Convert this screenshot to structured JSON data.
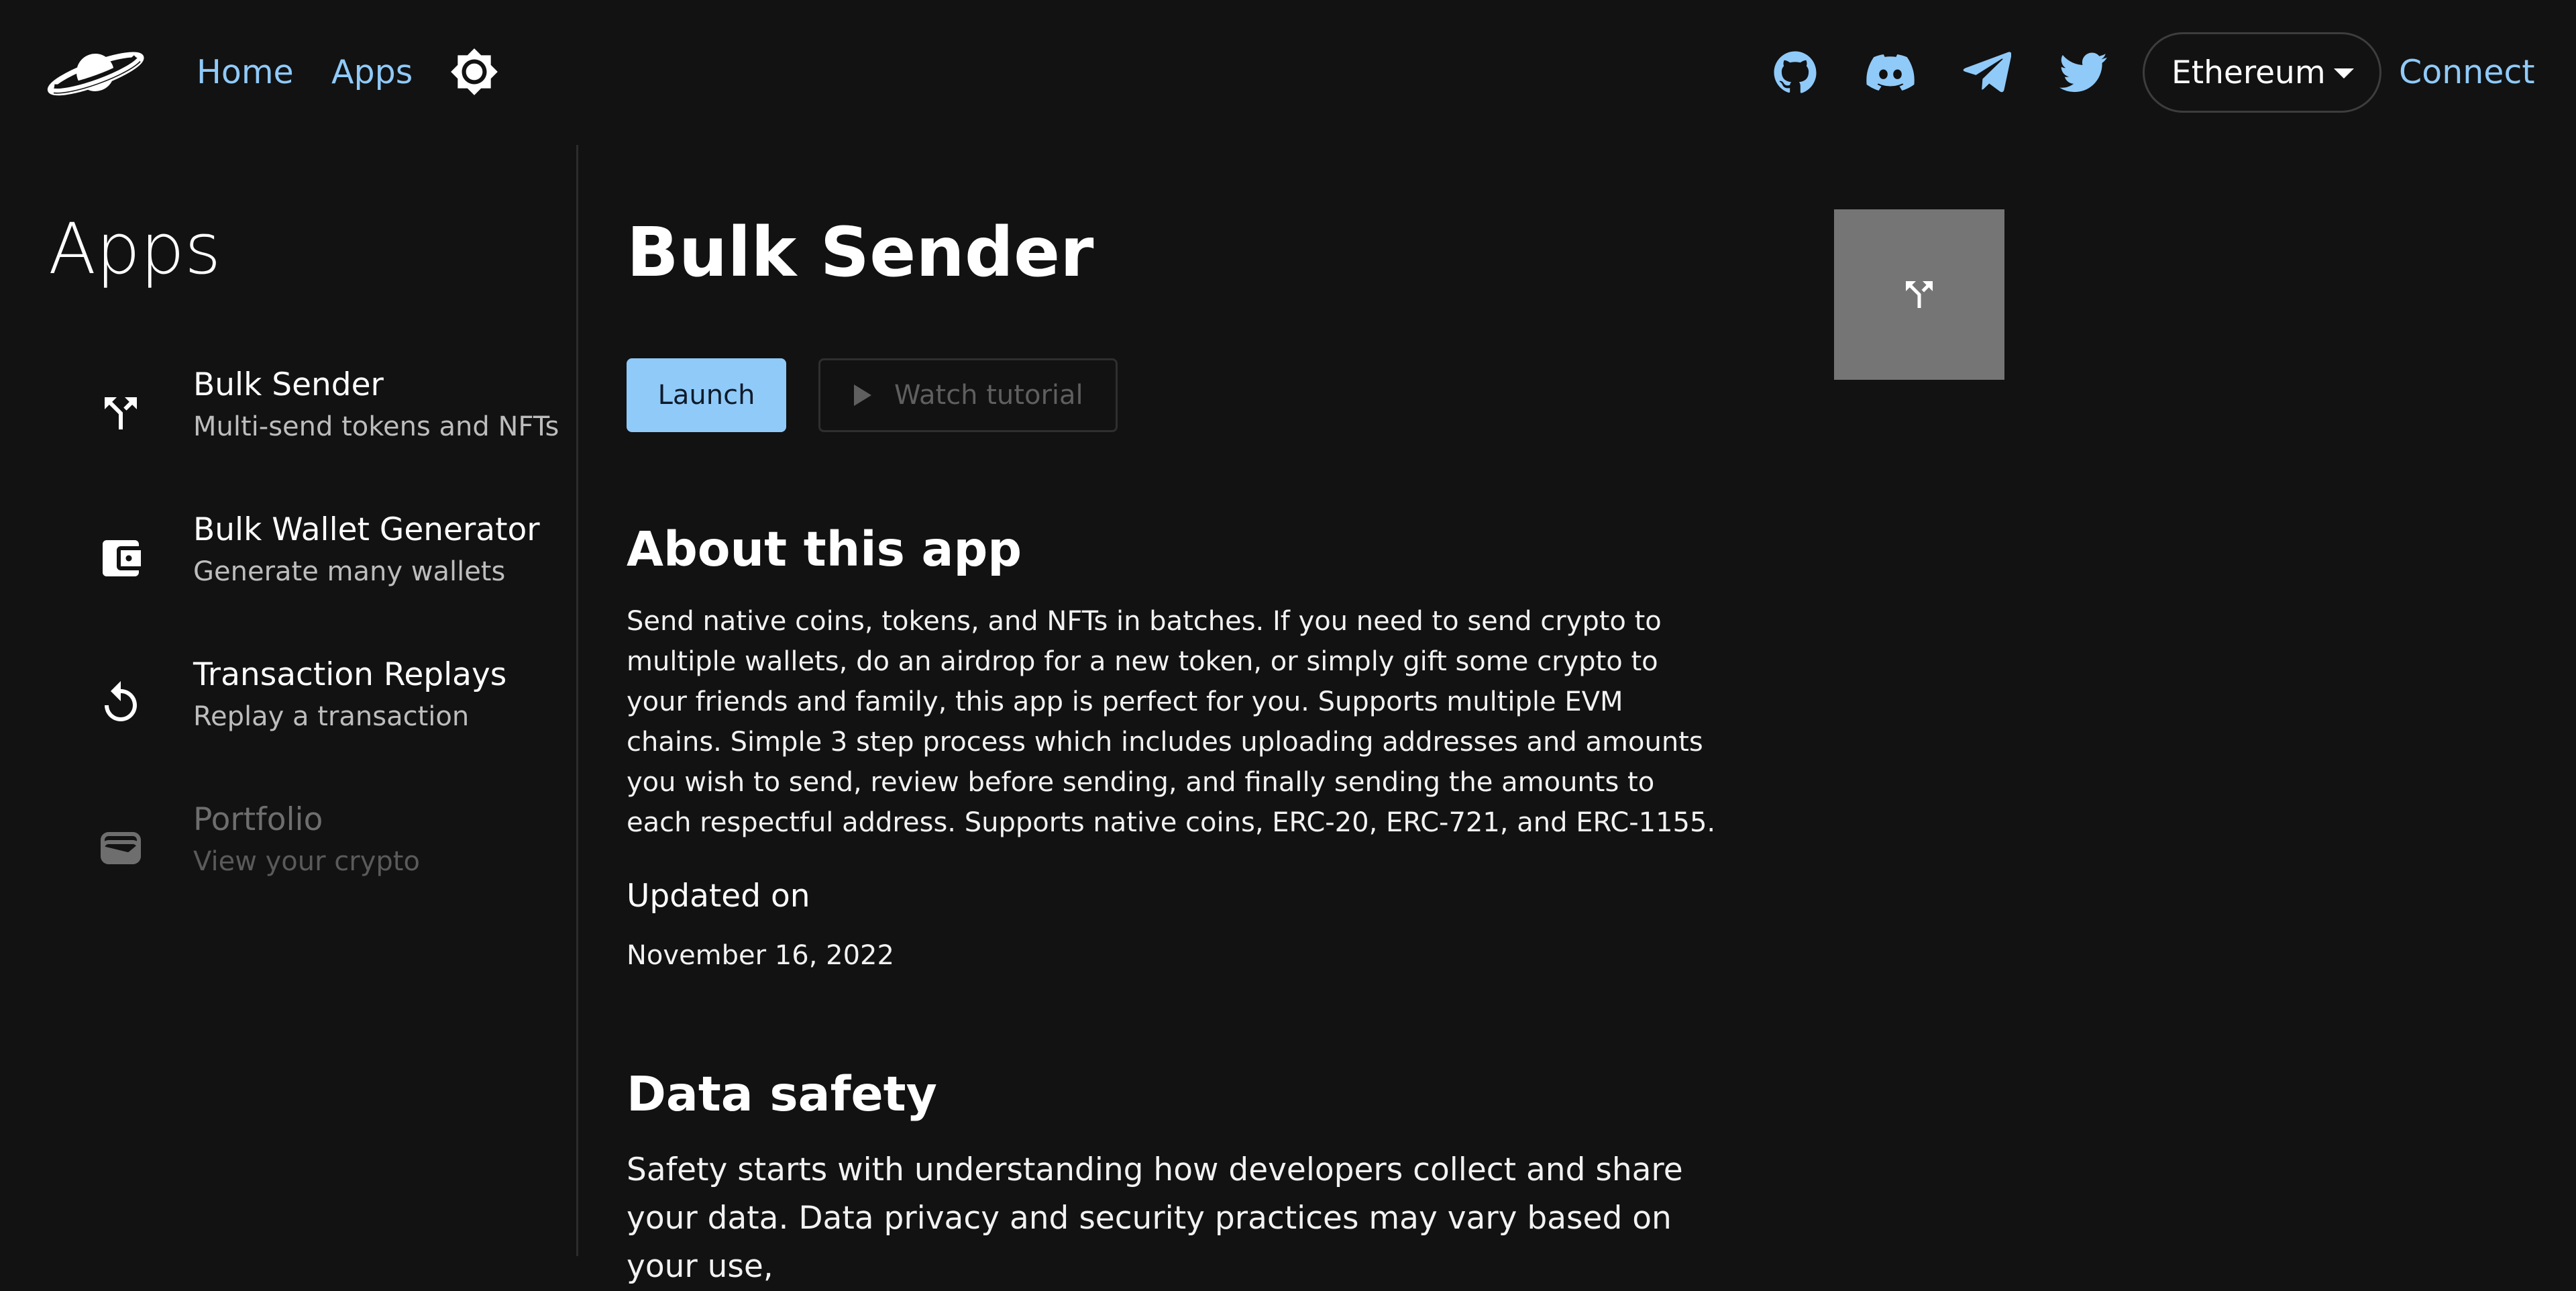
{
  "header": {
    "nav": {
      "home": "Home",
      "apps": "Apps"
    },
    "network": {
      "selected": "Ethereum"
    },
    "connect_label": "Connect",
    "social_icons": [
      "github-icon",
      "discord-icon",
      "telegram-icon",
      "twitter-icon"
    ]
  },
  "sidebar": {
    "title": "Apps",
    "items": [
      {
        "title": "Bulk Sender",
        "subtitle": "Multi-send tokens and NFTs",
        "icon": "call-split-icon",
        "enabled": true
      },
      {
        "title": "Bulk Wallet Generator",
        "subtitle": "Generate many wallets",
        "icon": "wallet-icon",
        "enabled": true
      },
      {
        "title": "Transaction Replays",
        "subtitle": "Replay a transaction",
        "icon": "replay-icon",
        "enabled": true
      },
      {
        "title": "Portfolio",
        "subtitle": "View your crypto",
        "icon": "card-wallet-icon",
        "enabled": false
      }
    ]
  },
  "main": {
    "title": "Bulk Sender",
    "launch_label": "Launch",
    "watch_label": "Watch tutorial",
    "about": {
      "heading": "About this app",
      "text": "Send native coins, tokens, and NFTs in batches. If you need to send crypto to multiple wallets, do an airdrop for a new token, or simply gift some crypto to your friends and family, this app is perfect for you. Supports multiple EVM chains. Simple 3 step process which includes uploading addresses and amounts you wish to send, review before sending, and finally sending the amounts to each respectful address. Supports native coins, ERC-20, ERC-721, and ERC-1155."
    },
    "updated": {
      "label": "Updated on",
      "value": "November 16, 2022"
    },
    "data_safety": {
      "heading": "Data safety",
      "text": "Safety starts with understanding how developers collect and share your data. Data privacy and security practices may vary based on your use,"
    }
  },
  "colors": {
    "accent": "#90caf9",
    "background": "#121212",
    "thumb": "#757575"
  }
}
